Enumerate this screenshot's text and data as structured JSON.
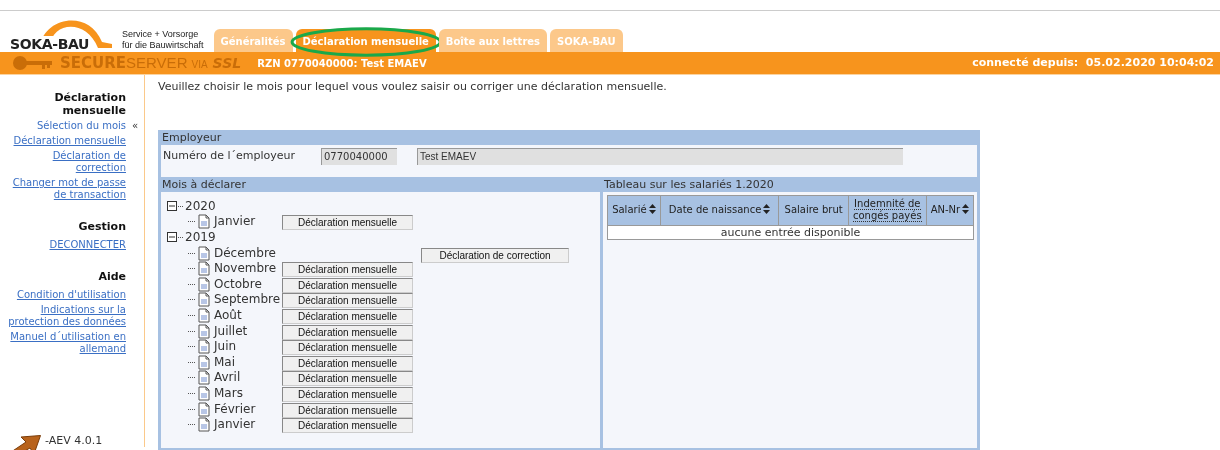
{
  "header": {
    "logo": "SOKA-BAU",
    "tagline": [
      "Service + Vorsorge",
      "für die Bauwirtschaft"
    ],
    "tabs": [
      {
        "label": "Généralités",
        "selected": false
      },
      {
        "label": "Déclaration mensuelle",
        "selected": true
      },
      {
        "label": "Boîte aux lettres",
        "selected": false
      },
      {
        "label": "SOKA-BAU",
        "selected": false
      }
    ]
  },
  "status_bar": {
    "secure_parts": [
      "SECURE",
      "SERVER",
      "VIA",
      "SSL"
    ],
    "account": "RZN 0770040000: Test EMAEV",
    "connected": "connecté depuis:  05.02.2020 10:04:02"
  },
  "sidebar": {
    "current_marker": "«",
    "sections": [
      {
        "title": "Déclaration mensuelle",
        "items": [
          {
            "label": "Sélection du mois",
            "selected": true
          },
          {
            "label": "Déclaration mensuelle",
            "selected": false
          },
          {
            "label": "Déclaration de correction",
            "selected": false
          },
          {
            "label": "Changer mot de passe de transaction",
            "selected": false
          }
        ]
      },
      {
        "title": "Gestion",
        "items": [
          {
            "label": "DECONNECTER",
            "selected": false
          }
        ]
      },
      {
        "title": "Aide",
        "items": [
          {
            "label": "Condition d'utilisation",
            "selected": false
          },
          {
            "label": "Indications sur la protection des données",
            "selected": false
          },
          {
            "label": "Manuel d´utilisation en allemand",
            "selected": false
          }
        ]
      }
    ],
    "version": "-AEV 4.0.1"
  },
  "intro": "Veuillez choisir le mois pour lequel vous voulez saisir ou corriger une déclaration mensuelle.",
  "employer": {
    "title": "Employeur",
    "label": "Numéro de l´employeur",
    "number": "0770040000",
    "name": "Test EMAEV"
  },
  "months": {
    "title": "Mois à déclarer",
    "tree": [
      {
        "label": "2020",
        "expanded": true,
        "children": [
          {
            "label": "Janvier",
            "action": {
              "kind": "monthly",
              "label": "Déclaration mensuelle"
            }
          }
        ]
      },
      {
        "label": "2019",
        "expanded": true,
        "children": [
          {
            "label": "Décembre",
            "action": {
              "kind": "correction",
              "label": "Déclaration de correction"
            }
          },
          {
            "label": "Novembre",
            "action": {
              "kind": "monthly",
              "label": "Déclaration mensuelle"
            }
          },
          {
            "label": "Octobre",
            "action": {
              "kind": "monthly",
              "label": "Déclaration mensuelle"
            }
          },
          {
            "label": "Septembre",
            "action": {
              "kind": "monthly",
              "label": "Déclaration mensuelle"
            }
          },
          {
            "label": "Août",
            "action": {
              "kind": "monthly",
              "label": "Déclaration mensuelle"
            }
          },
          {
            "label": "Juillet",
            "action": {
              "kind": "monthly",
              "label": "Déclaration mensuelle"
            }
          },
          {
            "label": "Juin",
            "action": {
              "kind": "monthly",
              "label": "Déclaration mensuelle"
            }
          },
          {
            "label": "Mai",
            "action": {
              "kind": "monthly",
              "label": "Déclaration mensuelle"
            }
          },
          {
            "label": "Avril",
            "action": {
              "kind": "monthly",
              "label": "Déclaration mensuelle"
            }
          },
          {
            "label": "Mars",
            "action": {
              "kind": "monthly",
              "label": "Déclaration mensuelle"
            }
          },
          {
            "label": "Février",
            "action": {
              "kind": "monthly",
              "label": "Déclaration mensuelle"
            }
          },
          {
            "label": "Janvier",
            "action": {
              "kind": "monthly",
              "label": "Déclaration mensuelle"
            }
          }
        ]
      }
    ]
  },
  "employees": {
    "title": "Tableau sur les salariés 1.2020",
    "table": {
      "columns": [
        {
          "label": "Salarié",
          "sortable": true
        },
        {
          "label": "Date de naissance",
          "sortable": true
        },
        {
          "label": "Salaire brut",
          "sortable": false
        },
        {
          "label": "Indemnité de congés payés",
          "sortable": false
        },
        {
          "label": "AN-Nr",
          "sortable": true
        }
      ],
      "empty": "aucune entrée disponible"
    }
  }
}
